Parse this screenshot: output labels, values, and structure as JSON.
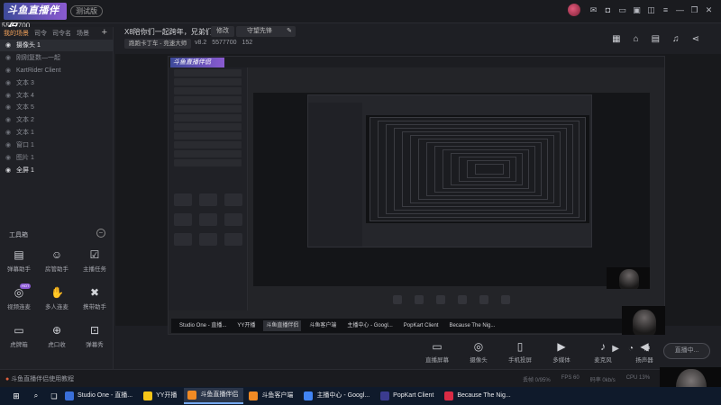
{
  "app": {
    "logo_text": "斗鱼直播伴侣",
    "beta_label": "测试版",
    "room_id": "5577700"
  },
  "scene_tabs": [
    "我的场景",
    "司令",
    "司令名",
    "场景"
  ],
  "sources": [
    {
      "label": "摄像头 1",
      "on": true,
      "selected": true
    },
    {
      "label": "刚刚复数—一起",
      "on": false
    },
    {
      "label": "KartRider Client",
      "on": false
    },
    {
      "label": "文本 3",
      "on": false
    },
    {
      "label": "文本 4",
      "on": false
    },
    {
      "label": "文本 5",
      "on": false
    },
    {
      "label": "文本 2",
      "on": false
    },
    {
      "label": "文本 1",
      "on": false
    },
    {
      "label": "窗口 1",
      "on": false
    },
    {
      "label": "图片 1",
      "on": false
    },
    {
      "label": "全屏 1",
      "on": true
    }
  ],
  "tools": {
    "title": "工具箱",
    "items": [
      {
        "label": "弹幕助手",
        "icon": "danmu-icon"
      },
      {
        "label": "房管助手",
        "icon": "admin-icon"
      },
      {
        "label": "主播任务",
        "icon": "task-icon"
      },
      {
        "label": "视频连麦",
        "icon": "video-link-icon",
        "badge": "HOT"
      },
      {
        "label": "多人连麦",
        "icon": "multi-link-icon"
      },
      {
        "label": "携带助手",
        "icon": "helper-icon"
      },
      {
        "label": "虎牌箱",
        "icon": "box-icon"
      },
      {
        "label": "虎口收",
        "icon": "income-icon"
      },
      {
        "label": "弹幕秀",
        "icon": "show-icon"
      }
    ],
    "tutorial": "斗鱼直播伴侣使用教程"
  },
  "header": {
    "stream_title": "X8陪你们一起跨年，兄弟们。",
    "modify_label": "修改",
    "guard_label": "守望先锋",
    "category": "跑跑卡丁车 - 竞速大师",
    "level": "v8.2",
    "followers": "5577700",
    "hot": "152"
  },
  "footer_buttons": [
    {
      "label": "直播屏幕",
      "icon": "screen-icon"
    },
    {
      "label": "摄像头",
      "icon": "camera-icon"
    },
    {
      "label": "手机投屏",
      "icon": "phone-cast-icon"
    },
    {
      "label": "多媒体",
      "icon": "media-icon"
    },
    {
      "label": "麦克风",
      "icon": "mic-icon"
    },
    {
      "label": "扬声器",
      "icon": "speaker-icon"
    }
  ],
  "live_button": "直播中...",
  "mid_taskbar": [
    "Studio One - 直播...",
    "YY开播",
    "斗鱼直播伴侣",
    "斗鱼客户端",
    "主播中心 - Googl...",
    "PopKart Client",
    "Because The Nig..."
  ],
  "status": {
    "left_text": "斗鱼直播伴侣使用教程",
    "right_items": [
      "丢帧 0/95%",
      "FPS 60",
      "码率 0kb/s",
      "CPU 13%"
    ]
  },
  "taskbar": {
    "items": [
      {
        "label": "Studio One - 直播...",
        "color": "#3a6fd8"
      },
      {
        "label": "YY开播",
        "color": "#f5c518"
      },
      {
        "label": "斗鱼直播伴侣",
        "color": "#f08a24",
        "active": true
      },
      {
        "label": "斗鱼客户端",
        "color": "#f08a24"
      },
      {
        "label": "主播中心 - Googl...",
        "color": "#4285f4"
      },
      {
        "label": "PopKart Client",
        "color": "#3b3b8f"
      },
      {
        "label": "Because The Nig...",
        "color": "#d92b45"
      }
    ]
  }
}
